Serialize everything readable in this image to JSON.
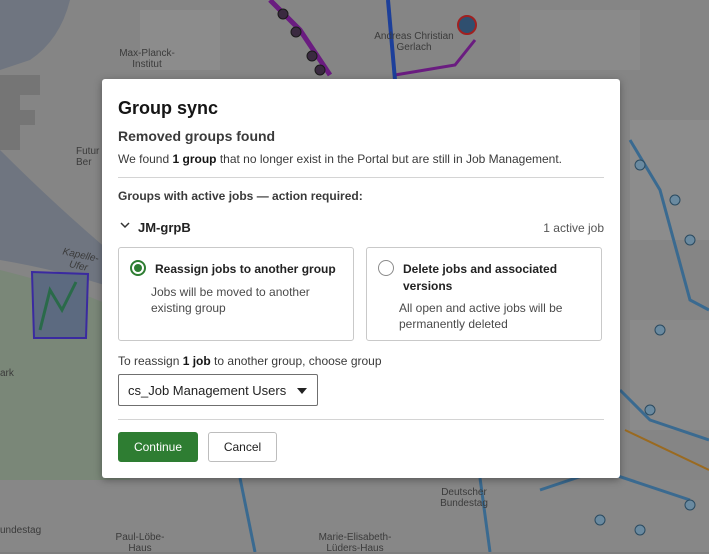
{
  "map": {
    "labels": {
      "max_planck": "Max-Planck-\nInstitut",
      "andreas": "Andreas Christian\nGerlach",
      "futur": "Futur\nBer",
      "kapelle": "Kapelle-Ufer",
      "ark": "ark",
      "deutscher": "Deutscher\nBundestag",
      "undestag": "undestag",
      "paul_loebe": "Paul-Löbe-\nHaus",
      "marie_elisabeth": "Marie-Elisabeth-\nLüders-Haus"
    }
  },
  "dialog": {
    "title": "Group sync",
    "subtitle": "Removed groups found",
    "description": {
      "prefix": "We found ",
      "count": "1 group",
      "suffix": " that no longer exist in the Portal but are still in Job Management."
    },
    "section_label": "Groups with active jobs — action required:",
    "group": {
      "name": "JM-grpB",
      "active_count": "1 active job"
    },
    "options": [
      {
        "title": "Reassign jobs to another group",
        "description": "Jobs will be moved to another existing group",
        "selected": true
      },
      {
        "title": "Delete jobs and associated versions",
        "description": "All open and active jobs will be permanently deleted",
        "selected": false
      }
    ],
    "reassign": {
      "prefix": "To reassign ",
      "count": "1 job",
      "suffix": " to another group, choose group",
      "selected_group": "cs_Job Management Users"
    },
    "buttons": {
      "continue": "Continue",
      "cancel": "Cancel"
    }
  },
  "colors": {
    "primary": "#2e7d32",
    "map_overlay": "#7e7e7e"
  }
}
